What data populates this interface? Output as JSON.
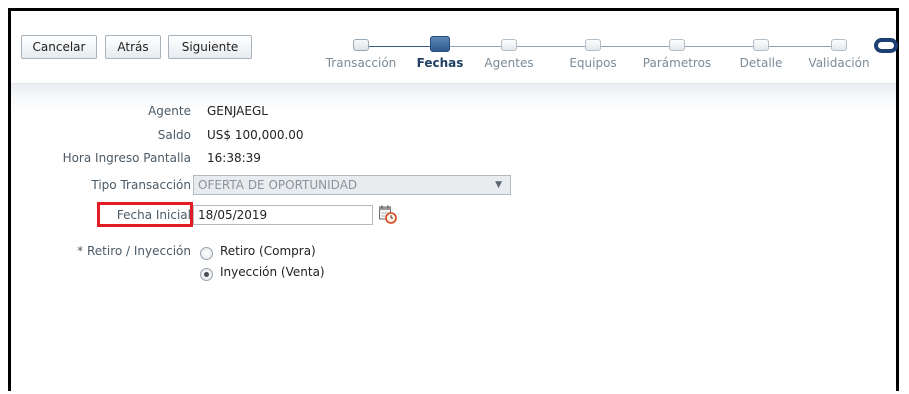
{
  "toolbar": {
    "cancel_label": "Cancelar",
    "back_label": "Atrás",
    "next_label": "Siguiente"
  },
  "train": {
    "steps": [
      {
        "label": "Transacción",
        "state": "visited"
      },
      {
        "label": "Fechas",
        "state": "current"
      },
      {
        "label": "Agentes",
        "state": "unvisited"
      },
      {
        "label": "Equipos",
        "state": "unvisited"
      },
      {
        "label": "Parámetros",
        "state": "unvisited"
      },
      {
        "label": "Detalle",
        "state": "unvisited"
      },
      {
        "label": "Validación",
        "state": "unvisited"
      }
    ]
  },
  "form": {
    "agente_label": "Agente",
    "agente_value": "GENJAEGL",
    "saldo_label": "Saldo",
    "saldo_value": "US$ 100,000.00",
    "hora_label": "Hora Ingreso Pantalla",
    "hora_value": "16:38:39",
    "tipo_label": "Tipo Transacción",
    "tipo_value": "OFERTA DE OPORTUNIDAD",
    "fecha_label": "Fecha Inicial",
    "fecha_value": "18/05/2019",
    "retiro_label": "* Retiro / Inyección",
    "options": [
      {
        "label": "Retiro (Compra)",
        "selected": false
      },
      {
        "label": "Inyección (Venta)",
        "selected": true
      }
    ]
  },
  "colors": {
    "accent": "#2d5b8c",
    "highlight": "#e31b23",
    "logo": "#1e3f73"
  },
  "icons": [
    "calendar-clock-icon",
    "oracle-logo"
  ]
}
